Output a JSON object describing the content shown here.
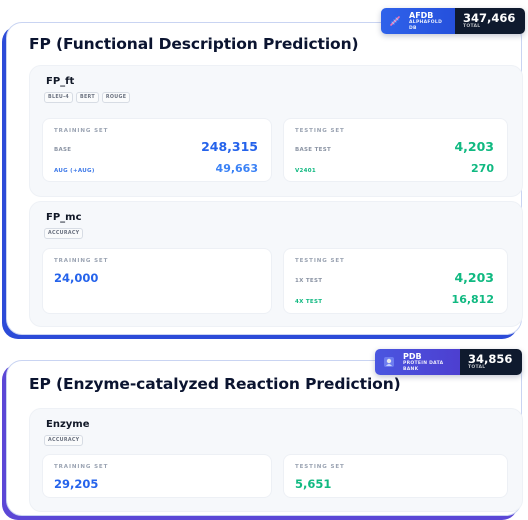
{
  "fp": {
    "title": "FP (Functional Description Prediction)",
    "badge": {
      "name": "AFDB",
      "sub": "ALPHAFOLD DB",
      "count": "347,466",
      "total": "TOTAL",
      "icon": "dna-icon"
    },
    "ft": {
      "title": "FP_ft",
      "metrics": [
        "BLEU-4",
        "BERT",
        "ROUGE"
      ],
      "training": {
        "header": "TRAINING SET",
        "rows": [
          {
            "label": "BASE",
            "value": "248,315"
          },
          {
            "label": "AUG (+AUG)",
            "value": "49,663"
          }
        ]
      },
      "testing": {
        "header": "TESTING SET",
        "rows": [
          {
            "label": "BASE TEST",
            "value": "4,203"
          },
          {
            "label": "V2401",
            "value": "270"
          }
        ]
      }
    },
    "mc": {
      "title": "FP_mc",
      "metrics": [
        "ACCURACY"
      ],
      "training": {
        "header": "TRAINING SET",
        "value": "24,000"
      },
      "testing": {
        "header": "TESTING SET",
        "rows": [
          {
            "label": "1X TEST",
            "value": "4,203"
          },
          {
            "label": "4X TEST",
            "value": "16,812"
          }
        ]
      }
    }
  },
  "ep": {
    "title": "EP (Enzyme-catalyzed Reaction Prediction)",
    "badge": {
      "name": "PDB",
      "sub": "PROTEIN DATA BANK",
      "count": "34,856",
      "total": "TOTAL",
      "icon": "molecule-icon"
    },
    "enzyme": {
      "title": "Enzyme",
      "metrics": [
        "ACCURACY"
      ],
      "training": {
        "header": "TRAINING SET",
        "value": "29,205"
      },
      "testing": {
        "header": "TESTING SET",
        "value": "5,651"
      }
    }
  },
  "colors": {
    "accent_blue": "#2563eb",
    "accent_green": "#10b981",
    "badge_dark": "#0f1a2e",
    "fp_border": "#2c4bd8",
    "ep_border": "#5b47d6"
  }
}
